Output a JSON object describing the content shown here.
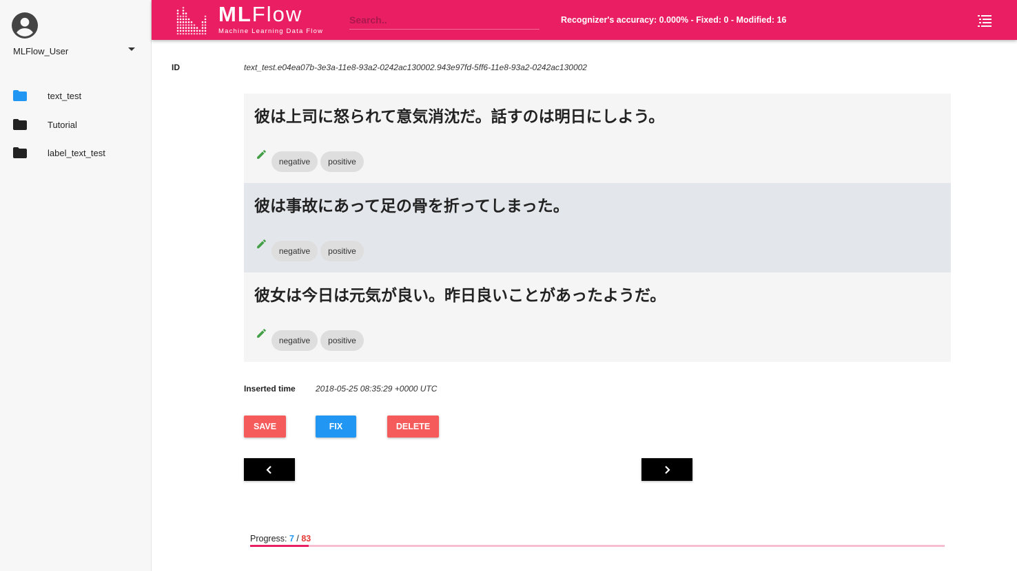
{
  "sidebar": {
    "user_name": "MLFlow_User",
    "items": [
      {
        "label": "text_test",
        "folder_color": "#2196f3"
      },
      {
        "label": "Tutorial",
        "folder_color": "#222222"
      },
      {
        "label": "label_text_test",
        "folder_color": "#222222"
      }
    ]
  },
  "header": {
    "logo_title_bold": "ML",
    "logo_title_rest": "Flow",
    "logo_subtitle": "Machine Learning Data Flow",
    "search_placeholder": "Search..",
    "stats": "Recognizer's accuracy: 0.000% - Fixed: 0 - Modified: 16",
    "brand_color": "#e91e63"
  },
  "record": {
    "id_label": "ID",
    "id_value": "text_test.e04ea07b-3e3a-11e8-93a2-0242ac130002.943e97fd-5ff6-11e8-93a2-0242ac130002",
    "items": [
      {
        "text": "彼は上司に怒られて意気消沈だ。話すのは明日にしよう。",
        "labels": [
          "negative",
          "positive"
        ],
        "background": "#f5f5f5"
      },
      {
        "text": "彼は事故にあって足の骨を折ってしまった。",
        "labels": [
          "negative",
          "positive"
        ],
        "background": "#e3e6ea"
      },
      {
        "text": "彼女は今日は元気が良い。昨日良いことがあったようだ。",
        "labels": [
          "negative",
          "positive"
        ],
        "background": "#f5f5f5"
      }
    ],
    "inserted_label": "Inserted time",
    "inserted_value": "2018-05-25 08:35:29 +0000 UTC"
  },
  "actions": {
    "save": "SAVE",
    "fix": "FIX",
    "delete": "DELETE",
    "prev_icon": "chevron-left-icon",
    "next_icon": "chevron-right-icon"
  },
  "progress": {
    "label": "Progress:",
    "current": "7",
    "separator": " / ",
    "total": "83",
    "fraction": 0.0843
  }
}
